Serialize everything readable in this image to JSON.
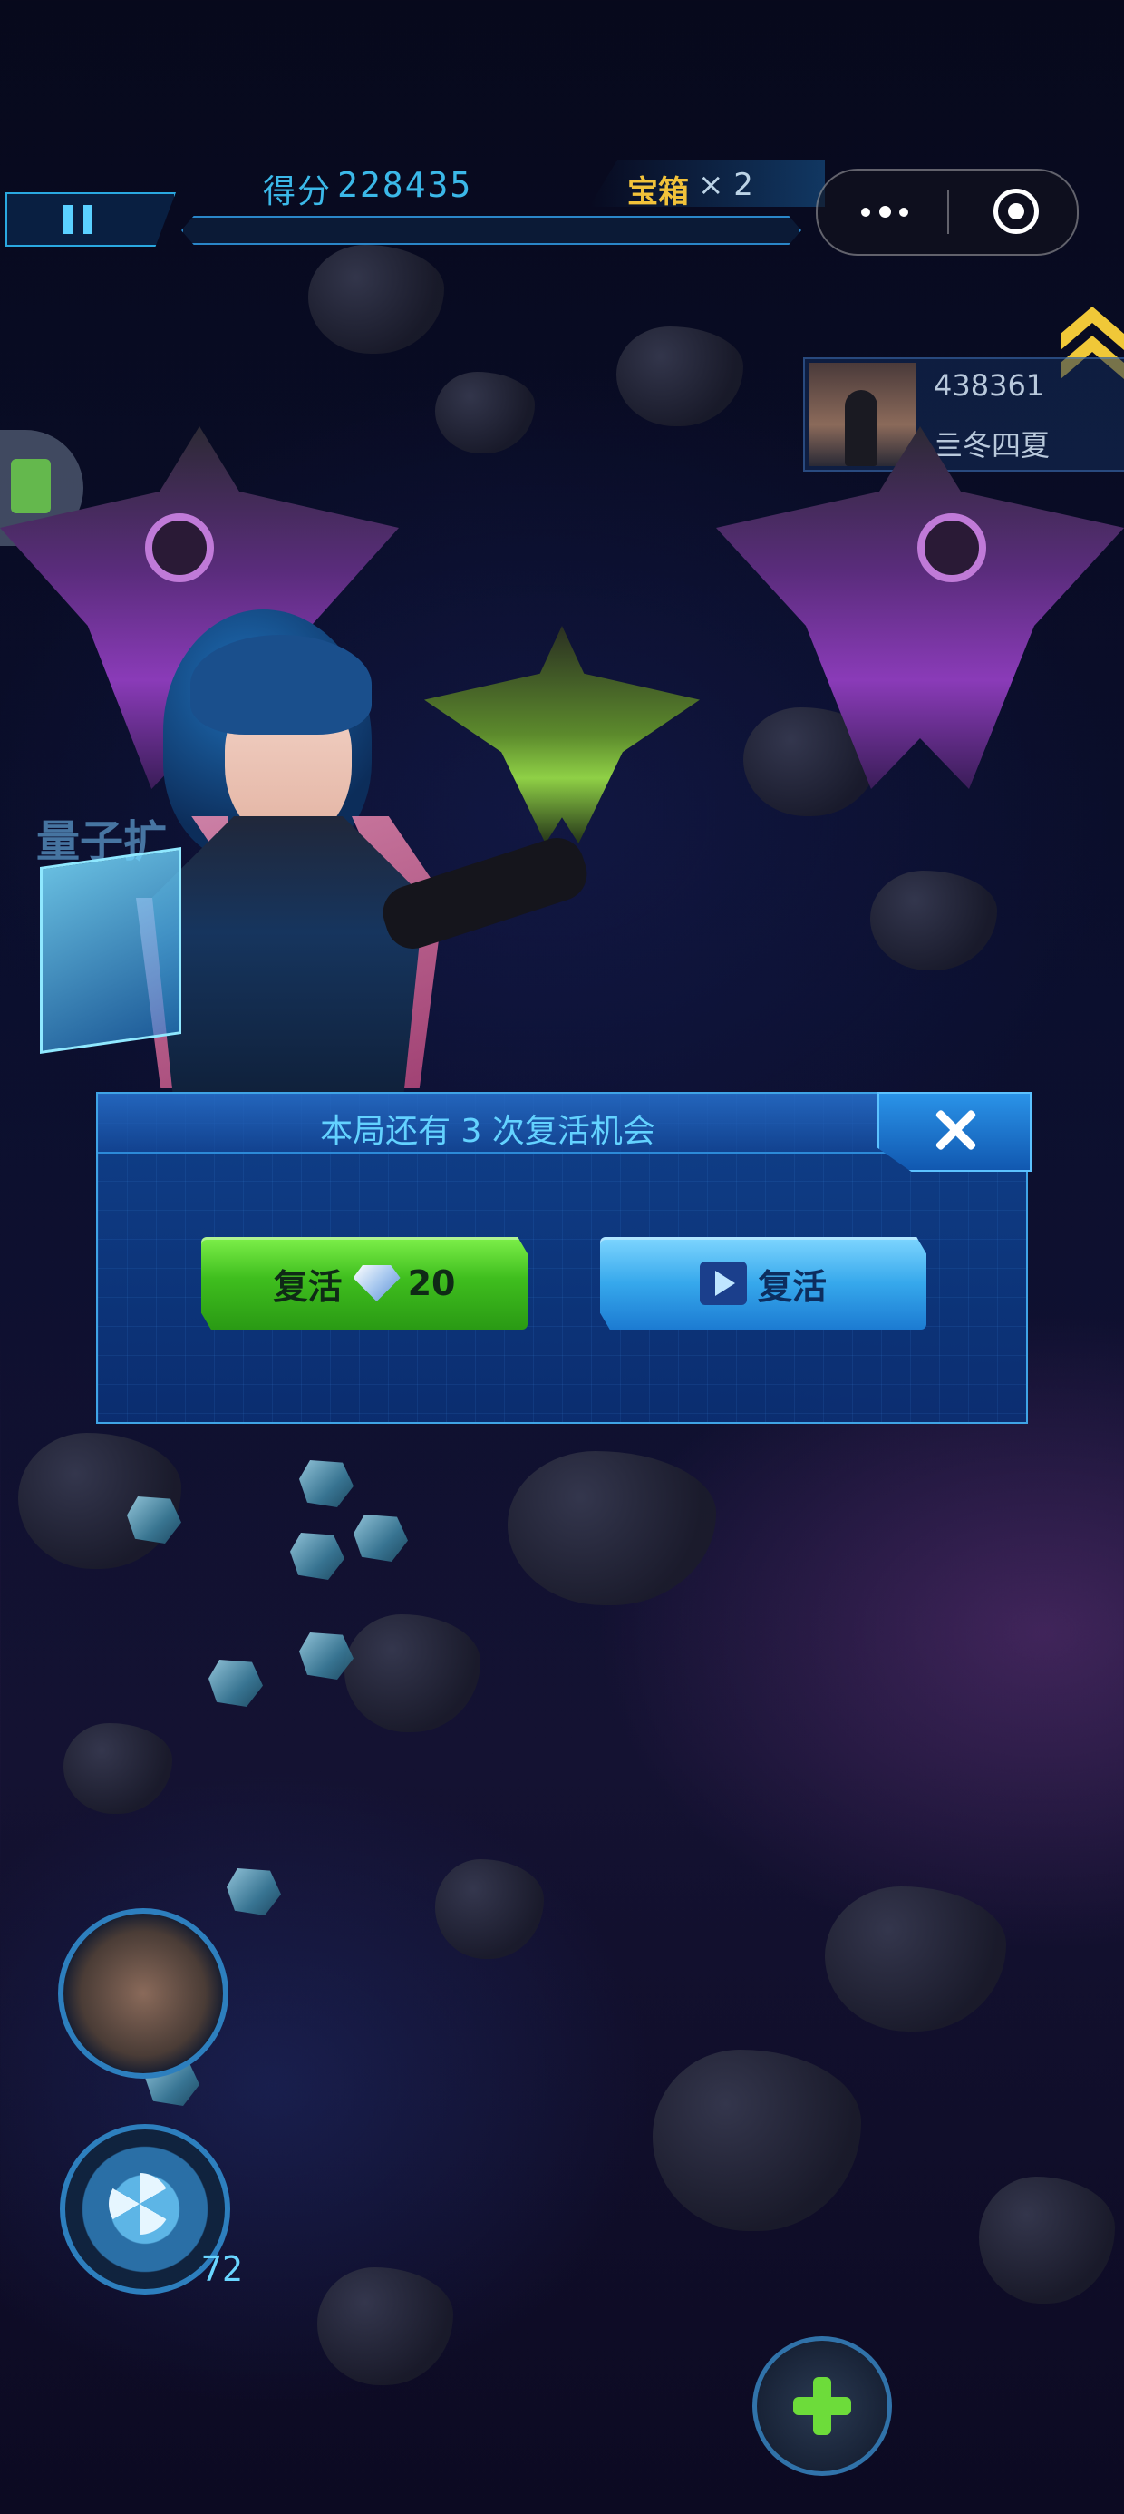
{
  "hud": {
    "score_label": "得分",
    "score_value": "228435",
    "chest_label": "宝箱",
    "chest_count": "× 2"
  },
  "player": {
    "score": "438361",
    "name": "亖冬四夏"
  },
  "revive_dialog": {
    "title": "本局还有 3 次复活机会",
    "gem_button_label": "复活",
    "gem_cost": "20",
    "video_button_label": "复活"
  },
  "bomb_count": "72",
  "ghost_text": "量子扩"
}
